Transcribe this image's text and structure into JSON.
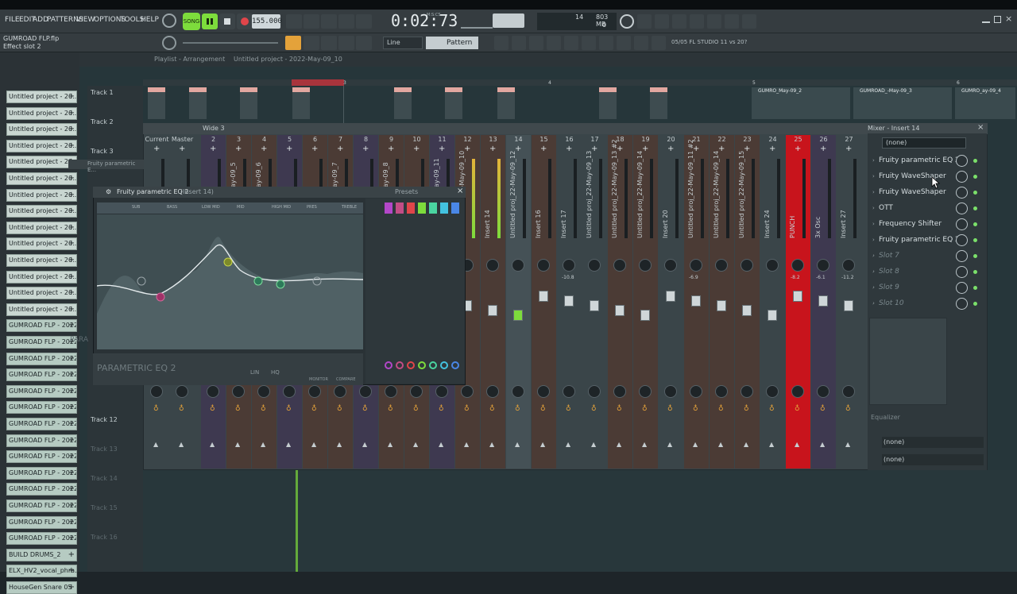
{
  "menu": [
    "FILE",
    "EDIT",
    "ADD",
    "PATTERNS",
    "VIEW",
    "OPTIONS",
    "TOOLS",
    "HELP"
  ],
  "transport": {
    "song_label": "SONG",
    "tempo": "155.000",
    "time": "0:02:73",
    "time_unit": "M:S:CS",
    "cpu": "14",
    "ram": "803 MB",
    "ram_sub": "0"
  },
  "hint": {
    "file": "GUMROAD FLP.flp",
    "effect": "Effect slot 2"
  },
  "toolbar": {
    "snap": "Line",
    "pattern": "Pattern 2",
    "version_info": "05/05  FL STUDIO 11 vs 20?"
  },
  "playlist": {
    "breadcrumb": "Playlist - Arrangement",
    "project": "Untitled project - 2022-May-09_10"
  },
  "bar_numbers": [
    "2",
    "3",
    "4",
    "5",
    "6"
  ],
  "clips": [
    {
      "label": "GUMRO_May-09_2"
    },
    {
      "label": "GUMROAD_-May-09_3"
    },
    {
      "label": "GUMRO_ay-09_4"
    }
  ],
  "sidebar_items": [
    "Untitled project - 20...",
    "Untitled project - 20...",
    "Untitled project - 20...",
    "Untitled project - 20...",
    "Untitled project - 20...",
    "Untitled project - 20...",
    "Untitled project - 20...",
    "Untitled project - 20...",
    "Untitled project - 20...",
    "Untitled project - 20...",
    "Untitled project - 20...",
    "Untitled project - 20...",
    "Untitled project - 20...",
    "Untitled project - 20...",
    "GUMROAD FLP - 2022...",
    "GUMROAD FLP - 2022...",
    "GUMROAD FLP - 2022...",
    "GUMROAD FLP - 2022...",
    "GUMROAD FLP - 2022...",
    "GUMROAD FLP - 2022...",
    "GUMROAD FLP - 2022...",
    "GUMROAD FLP - 2022...",
    "GUMROAD FLP - 2022...",
    "GUMROAD FLP - 2022...",
    "GUMROAD FLP - 2022...",
    "GUMROAD FLP - 2022...",
    "GUMROAD FLP - 2022...",
    "GUMROAD FLP - 2022...",
    "BUILD DRUMS_2",
    "ELX_HV2_vocal_phra...",
    "HouseGen Snare 05"
  ],
  "tracks": [
    "Track 1",
    "Track 2",
    "Track 3",
    "Track 12",
    "Track 13",
    "Track 14",
    "Track 15",
    "Track 16"
  ],
  "mixer": {
    "title": "Wide 3",
    "panel_title": "Mixer - Insert 14",
    "strip_labels": [
      "Current",
      "Master",
      "2",
      "3",
      "4",
      "5",
      "6",
      "7",
      "8",
      "9",
      "10",
      "11",
      "12",
      "13",
      "14",
      "15",
      "16",
      "17",
      "18",
      "19",
      "20",
      "21",
      "22",
      "23",
      "24",
      "25",
      "26",
      "27"
    ],
    "strip_names": [
      "",
      "",
      "",
      "Untitled proj...May-09_5",
      "Untitled proj...May-09_6",
      "",
      "",
      "Untitled proj...May-09_7",
      "",
      "Untitled proj...May-09_8",
      "",
      "Untitled proj...May-09_11",
      "Untitled proj_22-May-09_10",
      "Insert 14",
      "Untitled proj_22-May-09_12",
      "Insert 16",
      "Insert 17",
      "Untitled proj_22-May-09_13",
      "Untitled proj_22-May-09_13 #2",
      "Untitled proj_22-May-09_14",
      "Insert 20",
      "Untitled proj_22-May-09_11 #2",
      "Untitled proj_22-May-09_14",
      "Untitled proj_22-May-09_15",
      "Insert 24",
      "PUNCH",
      "3x Osc",
      "Insert 27"
    ],
    "db_values": [
      "",
      "",
      "",
      "",
      "",
      "",
      "",
      "",
      "",
      "",
      "",
      "",
      "",
      "",
      "",
      "",
      "-10.8",
      "",
      "",
      "",
      "",
      "-6.9",
      "",
      "",
      "",
      "-8.2",
      "-6.1",
      "-11.2"
    ]
  },
  "inserts": {
    "preset": "(none)",
    "slots": [
      {
        "name": "Fruity parametric EQ 2",
        "empty": false
      },
      {
        "name": "Fruity WaveShaper",
        "empty": false
      },
      {
        "name": "Fruity WaveShaper",
        "empty": false
      },
      {
        "name": "OTT",
        "empty": false
      },
      {
        "name": "Frequency Shifter",
        "empty": false
      },
      {
        "name": "Fruity parametric EQ 2",
        "empty": false
      },
      {
        "name": "Slot 7",
        "empty": true
      },
      {
        "name": "Slot 8",
        "empty": true
      },
      {
        "name": "Slot 9",
        "empty": true
      },
      {
        "name": "Slot 10",
        "empty": true
      }
    ],
    "equalizer_label": "Equalizer",
    "send_in": "(none)",
    "send_out": "(none)"
  },
  "eq": {
    "title": "Fruity parametric EQ 2",
    "insert": "(Insert 14)",
    "presets": "Presets",
    "band_labels": [
      "SUB",
      "BASS",
      "LOW MID",
      "MID",
      "HIGH MID",
      "PRES",
      "TREBLE"
    ],
    "brand": "PARAMETRIC EQ 2",
    "buttons": [
      "LIN",
      "HQ",
      "MONITOR",
      "COMPARE"
    ],
    "ghost_title": "Fruity parametric E...",
    "ghost_label": "PARA"
  },
  "colors": {
    "accent_green": "#7ddc3c",
    "punch_red": "#c8141c",
    "clip_pink": "#e2a7a0",
    "brown_strip": "#4b3b35",
    "purple_strip": "#3e3950"
  }
}
